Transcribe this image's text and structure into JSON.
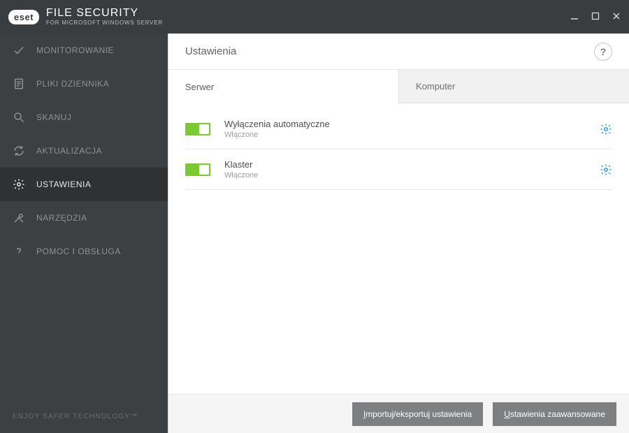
{
  "titlebar": {
    "logo_text": "eset",
    "title_main": "FILE SECURITY",
    "title_sub": "FOR MICROSOFT WINDOWS SERVER"
  },
  "sidebar": {
    "items": [
      {
        "label": "MONITOROWANIE",
        "icon": "check"
      },
      {
        "label": "PLIKI DZIENNIKA",
        "icon": "document"
      },
      {
        "label": "SKANUJ",
        "icon": "search"
      },
      {
        "label": "AKTUALIZACJA",
        "icon": "refresh"
      },
      {
        "label": "USTAWIENIA",
        "icon": "gear"
      },
      {
        "label": "NARZĘDZIA",
        "icon": "tools"
      },
      {
        "label": "POMOC I OBSŁUGA",
        "icon": "help"
      }
    ],
    "active_index": 4,
    "footer": "ENJOY SAFER TECHNOLOGY™"
  },
  "page": {
    "title": "Ustawienia",
    "help_symbol": "?"
  },
  "tabs": [
    {
      "label": "Serwer",
      "active": true
    },
    {
      "label": "Komputer",
      "active": false
    }
  ],
  "settings_rows": [
    {
      "title": "Wyłączenia automatyczne",
      "status": "Włączone",
      "enabled": true
    },
    {
      "title": "Klaster",
      "status": "Włączone",
      "enabled": true
    }
  ],
  "actions": {
    "import_export": {
      "u": "I",
      "rest": "mportuj/eksportuj ustawienia"
    },
    "advanced": {
      "u": "U",
      "rest": "stawienia zaawansowane"
    }
  }
}
